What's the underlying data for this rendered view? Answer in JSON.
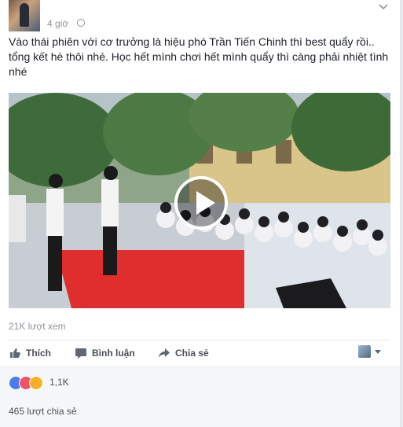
{
  "post": {
    "time": "4 giờ",
    "text": "Vào thái phiên với cơ trưởng là hiệu phó Trần Tiến Chinh thì best quẩy rồi.. tổng kết hè thôi nhé. Học hết mình chơi hết mình quẩy thì càng phải nhiệt tình nhé",
    "views": "21K lượt xem"
  },
  "actions": {
    "like": "Thích",
    "comment": "Bình luận",
    "share": "Chia sẻ"
  },
  "reactions": {
    "count": "1,1K",
    "types": [
      "like-icon",
      "love-icon",
      "haha-icon"
    ]
  },
  "shares": "465 lượt chia sẻ",
  "colors": {
    "meta_text": "#90949c",
    "action_text": "#4b4f56",
    "like_blue": "#4b7bec",
    "love_red": "#f25268",
    "haha_yellow": "#f7b125"
  }
}
